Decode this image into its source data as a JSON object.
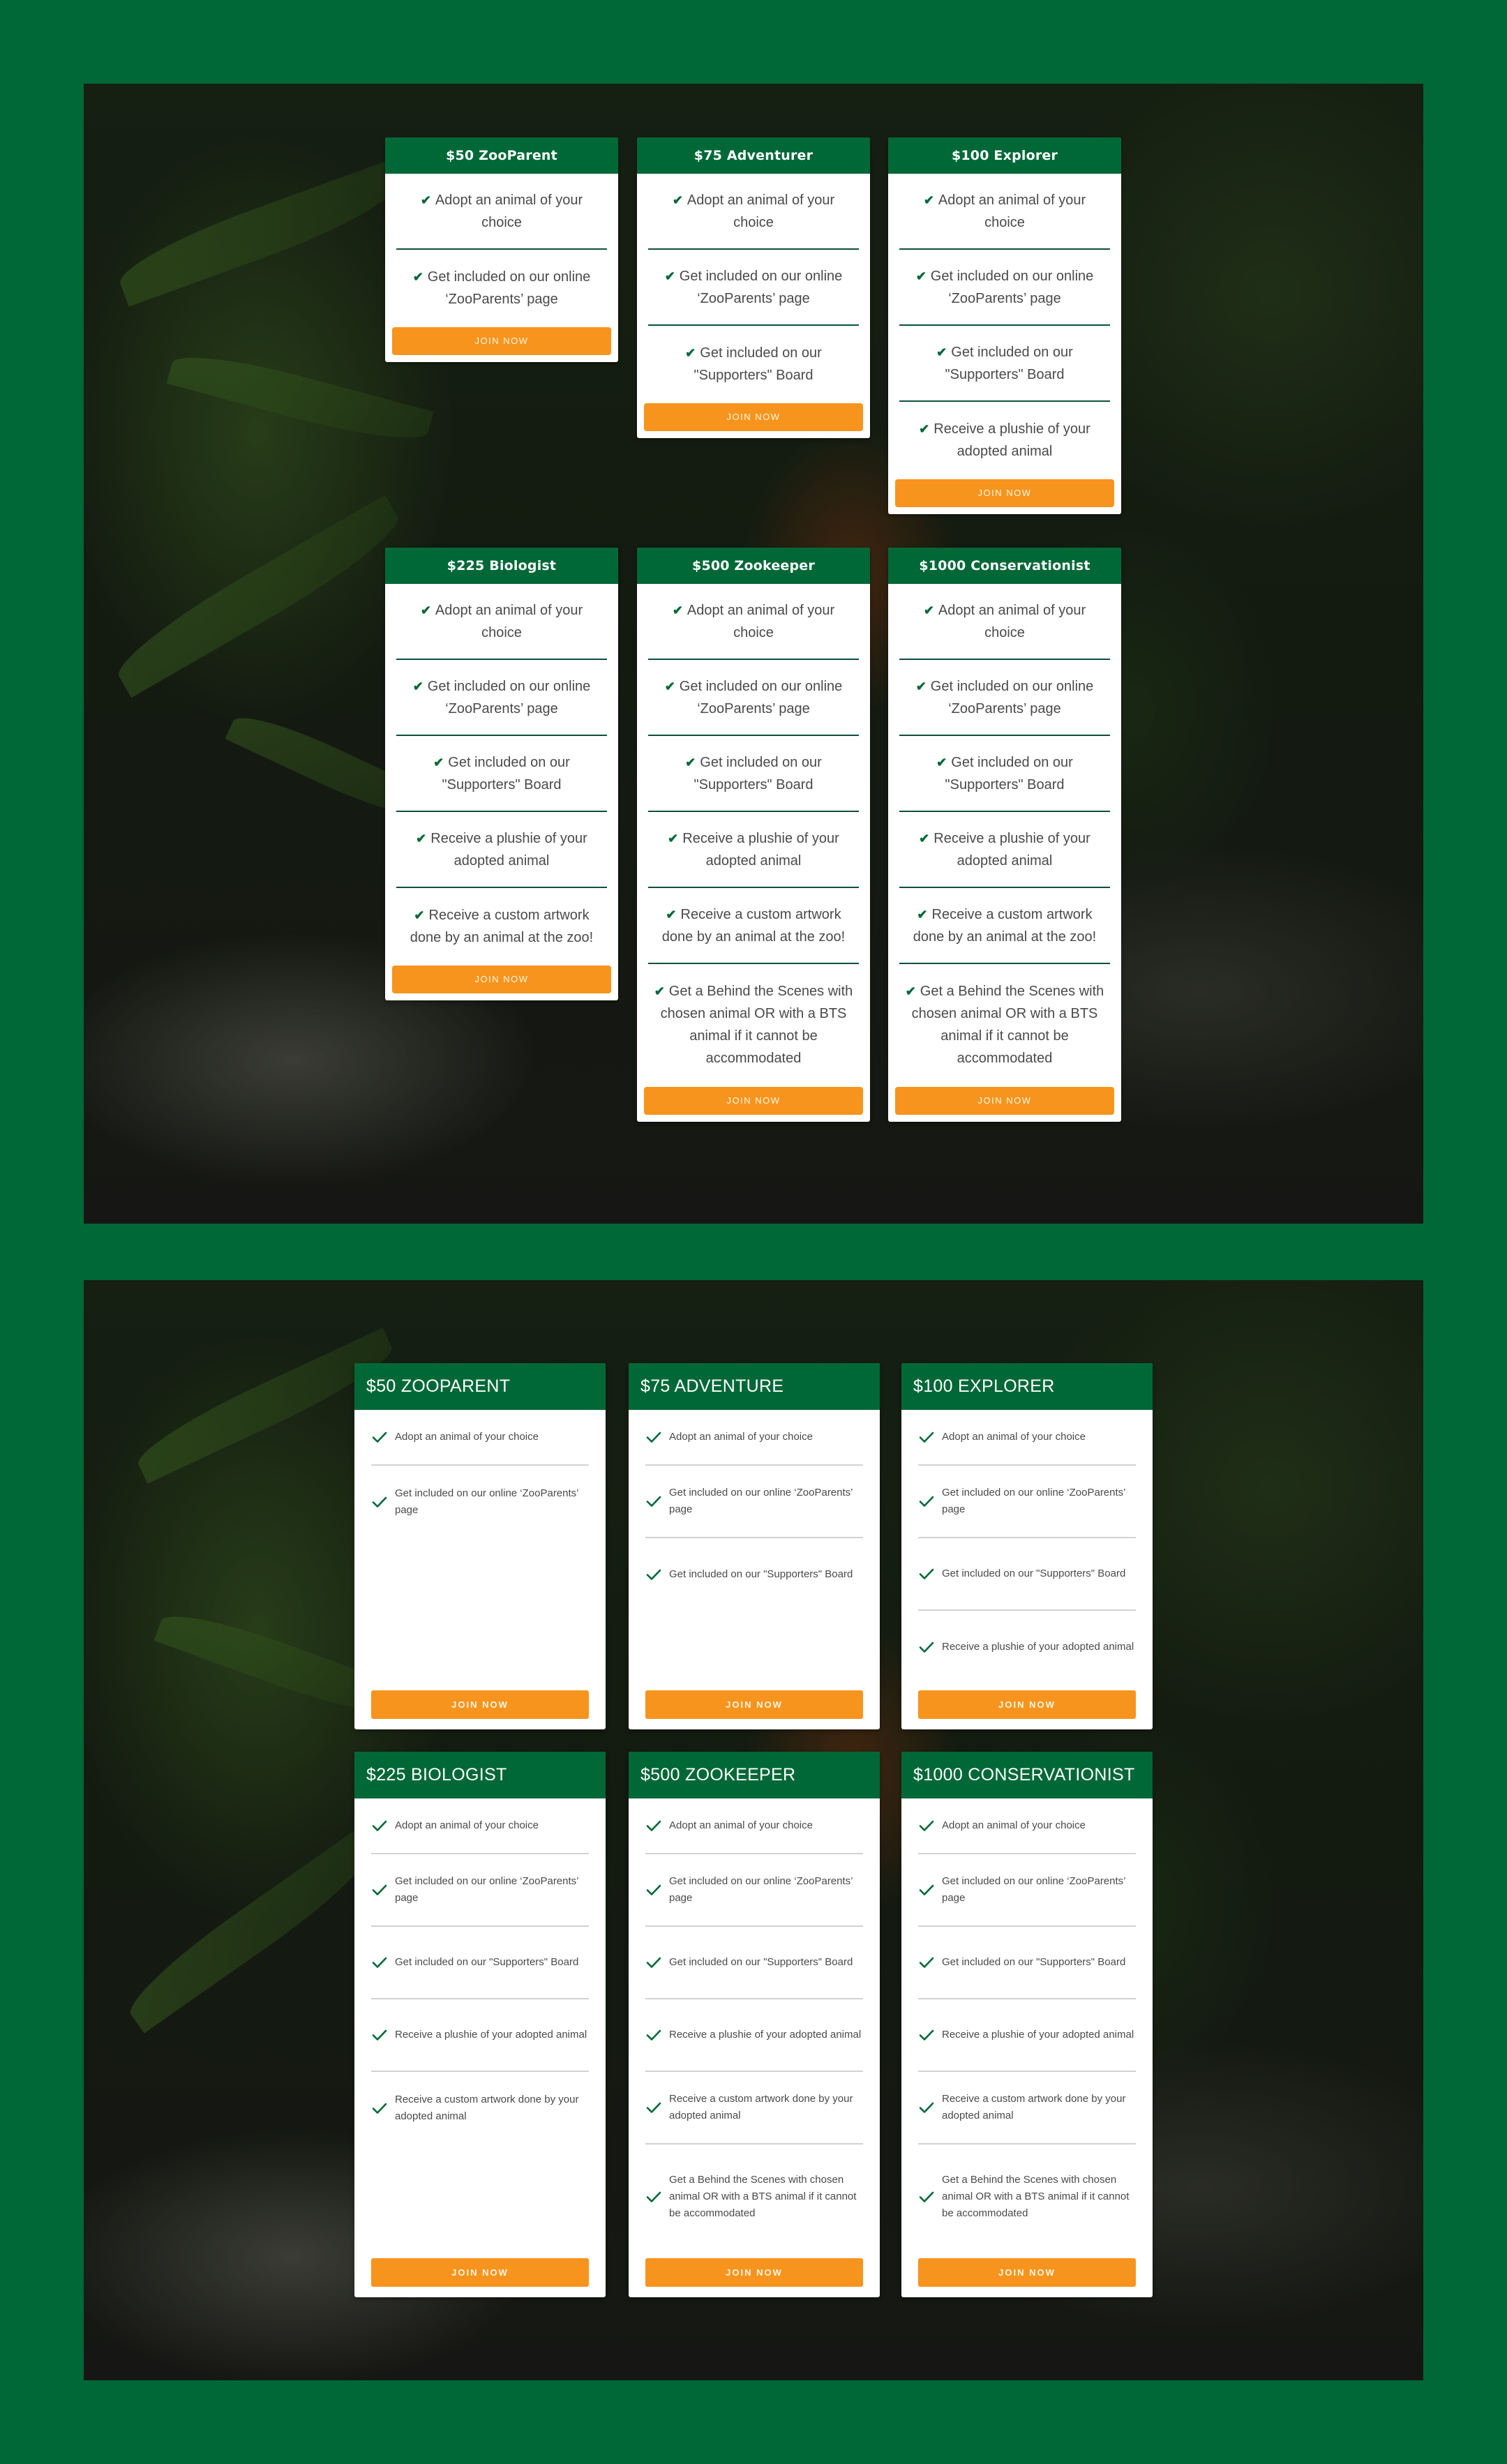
{
  "colors": {
    "page_background": "#006837",
    "header_green": "#006837",
    "button_orange": "#f7941d",
    "check_green": "#006837"
  },
  "icons": {
    "check": "check-icon"
  },
  "variant_a": {
    "button_label": "JOIN NOW",
    "check_glyph": "✔",
    "tiers": [
      {
        "title": "$50 ZooParent",
        "features": [
          "Adopt an animal of your choice",
          "Get included on our online ‘ZooParents’ page"
        ]
      },
      {
        "title": "$75 Adventurer",
        "features": [
          "Adopt an animal of your choice",
          "Get included on our online ‘ZooParents’ page",
          "Get included on our \"Supporters\" Board"
        ]
      },
      {
        "title": "$100 Explorer",
        "features": [
          "Adopt an animal of your choice",
          "Get included on our online ‘ZooParents’ page",
          "Get included on our \"Supporters\" Board",
          "Receive a plushie of your adopted animal"
        ]
      },
      {
        "title": "$225 Biologist",
        "features": [
          "Adopt an animal of your choice",
          "Get included on our online ‘ZooParents’ page",
          "Get included on our \"Supporters\" Board",
          "Receive a plushie of your adopted animal",
          "Receive a custom artwork done by an animal at the zoo!"
        ]
      },
      {
        "title": "$500 Zookeeper",
        "features": [
          "Adopt an animal of your choice",
          "Get included on our online ‘ZooParents’ page",
          "Get included on our \"Supporters\" Board",
          "Receive a plushie of your adopted animal",
          "Receive a custom artwork done by an animal at the zoo!",
          "Get a Behind the Scenes with chosen animal OR with a BTS animal if it cannot be accommodated"
        ]
      },
      {
        "title": "$1000 Conservationist",
        "features": [
          "Adopt an animal of your choice",
          "Get included on our online ‘ZooParents’ page",
          "Get included on our \"Supporters\" Board",
          "Receive a plushie of your adopted animal",
          "Receive a custom artwork done by an animal at the zoo!",
          "Get a Behind the Scenes with chosen animal OR with a BTS animal if it cannot be accommodated"
        ]
      }
    ]
  },
  "variant_b": {
    "button_label": "JOIN NOW",
    "tiers": [
      {
        "title": "$50 ZOOPARENT",
        "features": [
          "Adopt an animal of your choice",
          "Get included on our online ‘ZooParents’ page"
        ]
      },
      {
        "title": "$75 ADVENTURE",
        "features": [
          "Adopt an animal of your choice",
          "Get included on our online ‘ZooParents’ page",
          "Get included on our \"Supporters\" Board"
        ]
      },
      {
        "title": "$100 EXPLORER",
        "features": [
          "Adopt an animal of your choice",
          "Get included on our online ‘ZooParents’ page",
          "Get included on our \"Supporters\" Board",
          "Receive a plushie of your adopted animal"
        ]
      },
      {
        "title": "$225 BIOLOGIST",
        "features": [
          "Adopt an animal of your choice",
          "Get included on our online ‘ZooParents’ page",
          "Get included on our \"Supporters\" Board",
          "Receive a plushie of your adopted animal",
          "Receive a custom artwork done by your adopted animal"
        ]
      },
      {
        "title": "$500 ZOOKEEPER",
        "features": [
          "Adopt an animal of your choice",
          "Get included on our online ‘ZooParents’ page",
          "Get included on our \"Supporters\" Board",
          "Receive a plushie of your adopted animal",
          "Receive a custom artwork done by your adopted animal",
          "Get a Behind the Scenes with chosen animal OR with a BTS animal if it cannot be accommodated"
        ]
      },
      {
        "title": "$1000 CONSERVATIONIST",
        "features": [
          "Adopt an animal of your choice",
          "Get included on our online ‘ZooParents’ page",
          "Get included on our \"Supporters\" Board",
          "Receive a plushie of your adopted animal",
          "Receive a custom artwork done by your adopted animal",
          "Get a Behind the Scenes with chosen animal OR with a BTS animal if it cannot be accommodated"
        ]
      }
    ]
  }
}
